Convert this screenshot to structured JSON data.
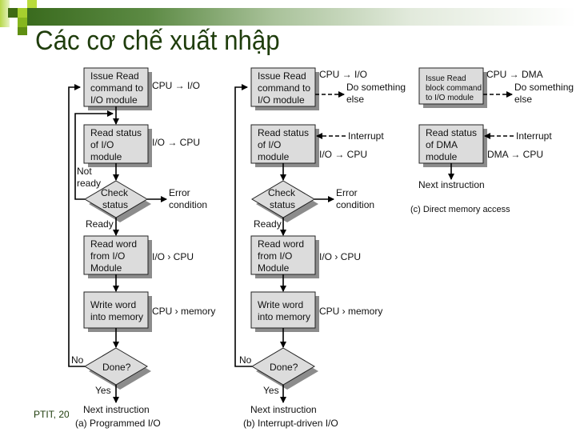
{
  "slide": {
    "title": "Các cơ chế xuất nhập",
    "footer": "PTIT, 20",
    "colors": {
      "title": "#1f3d0c",
      "accent_dark": "#3a6b1e",
      "accent_light": "#9ccc2a",
      "box_fill": "#dcdcdc",
      "shadow": "#8c8c8c"
    }
  },
  "programmed": {
    "caption": "(a) Programmed I/O",
    "issue": [
      "Issue Read",
      "command to",
      "I/O module"
    ],
    "issue_flow": "CPU → I/O",
    "read_status": [
      "Read status",
      "of I/O",
      "module"
    ],
    "status_flow": "I/O → CPU",
    "not_ready": [
      "Not",
      "ready"
    ],
    "check": [
      "Check",
      "status"
    ],
    "error": [
      "Error",
      "condition"
    ],
    "ready": "Ready",
    "read_word": [
      "Read word",
      "from I/O",
      "Module"
    ],
    "read_flow": "I/O   › CPU",
    "write_word": [
      "Write word",
      "into memory"
    ],
    "write_flow": "CPU   › memory",
    "no": "No",
    "done": "Done?",
    "yes": "Yes",
    "next": "Next instruction"
  },
  "interrupt": {
    "caption": "(b) Interrupt-driven I/O",
    "issue": [
      "Issue Read",
      "command to",
      "I/O module"
    ],
    "issue_flow": "CPU → I/O",
    "do_something": [
      "Do something",
      "else"
    ],
    "read_status": [
      "Read status",
      "of I/O",
      "module"
    ],
    "interrupt": "Interrupt",
    "status_flow": "I/O → CPU",
    "check": [
      "Check",
      "status"
    ],
    "error": [
      "Error",
      "condition"
    ],
    "ready": "Ready",
    "read_word": [
      "Read word",
      "from I/O",
      "Module"
    ],
    "read_flow": "I/O   › CPU",
    "write_word": [
      "Write word",
      "into memory"
    ],
    "write_flow": "CPU   › memory",
    "no": "No",
    "done": "Done?",
    "yes": "Yes",
    "next": "Next instruction"
  },
  "dma": {
    "caption": "(c) Direct memory access",
    "issue": [
      "Issue Read",
      "block command",
      "to I/O module"
    ],
    "issue_flow": "CPU → DMA",
    "do_something": [
      "Do something",
      "else"
    ],
    "read_status": [
      "Read status",
      "of DMA",
      "module"
    ],
    "interrupt": "Interrupt",
    "status_flow": "DMA → CPU",
    "next": "Next instruction"
  }
}
